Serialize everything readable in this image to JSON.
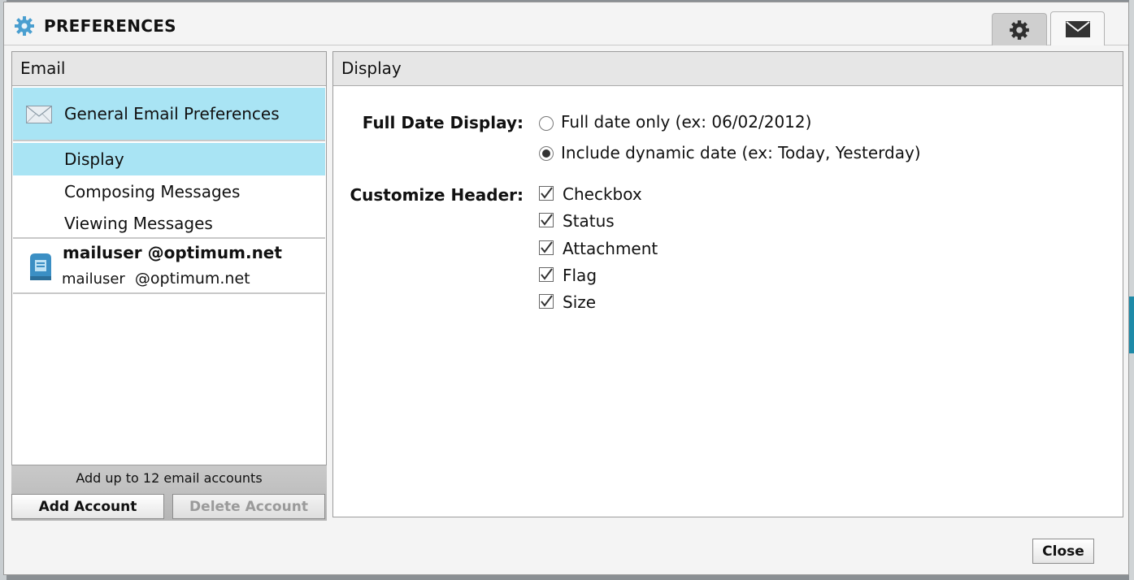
{
  "dialog": {
    "title": "PREFERENCES",
    "tabs": [
      {
        "icon": "gear-icon"
      },
      {
        "icon": "mail-icon"
      }
    ]
  },
  "left": {
    "header": "Email",
    "general": "General Email Preferences",
    "sub_items": [
      "Display",
      "Composing Messages",
      "Viewing Messages"
    ],
    "account": {
      "name": "mailuser @optimum.net",
      "user": "mailuser",
      "domain": "@optimum.net"
    },
    "footer_note": "Add up to 12 email accounts",
    "add_button": "Add Account",
    "delete_button": "Delete Account"
  },
  "right": {
    "header": "Display",
    "date_label": "Full Date Display:",
    "date_options": [
      "Full date only (ex: 06/02/2012)",
      "Include dynamic date (ex: Today, Yesterday)"
    ],
    "date_selected": 1,
    "header_label": "Customize Header:",
    "header_options": [
      "Checkbox",
      "Status",
      "Attachment",
      "Flag",
      "Size"
    ]
  },
  "close_button": "Close",
  "colors": {
    "selected": "#a9e4f4",
    "accent": "#3b8fc4"
  }
}
